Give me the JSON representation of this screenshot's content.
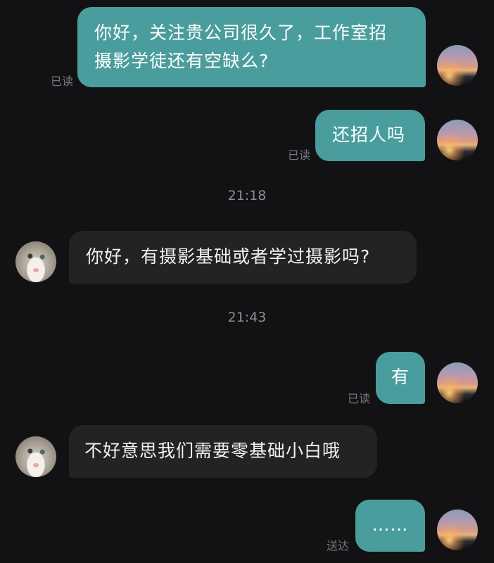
{
  "messages": [
    {
      "id": "m1",
      "dir": "out",
      "lines": [
        "你好，关注贵公司很久了，工作室招",
        "摄影学徒还有空缺么?"
      ],
      "status": "已读"
    },
    {
      "id": "m2",
      "dir": "out",
      "text": "还招人吗",
      "status": "已读"
    },
    {
      "id": "t1",
      "type": "time",
      "text": "21:18"
    },
    {
      "id": "m3",
      "dir": "in",
      "text": "你好，有摄影基础或者学过摄影吗?"
    },
    {
      "id": "t2",
      "type": "time",
      "text": "21:43"
    },
    {
      "id": "m4",
      "dir": "out",
      "text": "有",
      "status": "已读"
    },
    {
      "id": "m5",
      "dir": "in",
      "text": "不好意思我们需要零基础小白哦"
    },
    {
      "id": "m6",
      "dir": "out",
      "text": "……",
      "status": "送达"
    }
  ],
  "avatars": {
    "self": {
      "icon": "sunset-avatar-icon"
    },
    "contact": {
      "icon": "cat-avatar-icon"
    }
  },
  "colors": {
    "background": "#121214",
    "outgoing_bubble": "#4a9d9d",
    "incoming_bubble": "#232326",
    "status_text": "#77787c",
    "timestamp_text": "#8d8d92"
  }
}
